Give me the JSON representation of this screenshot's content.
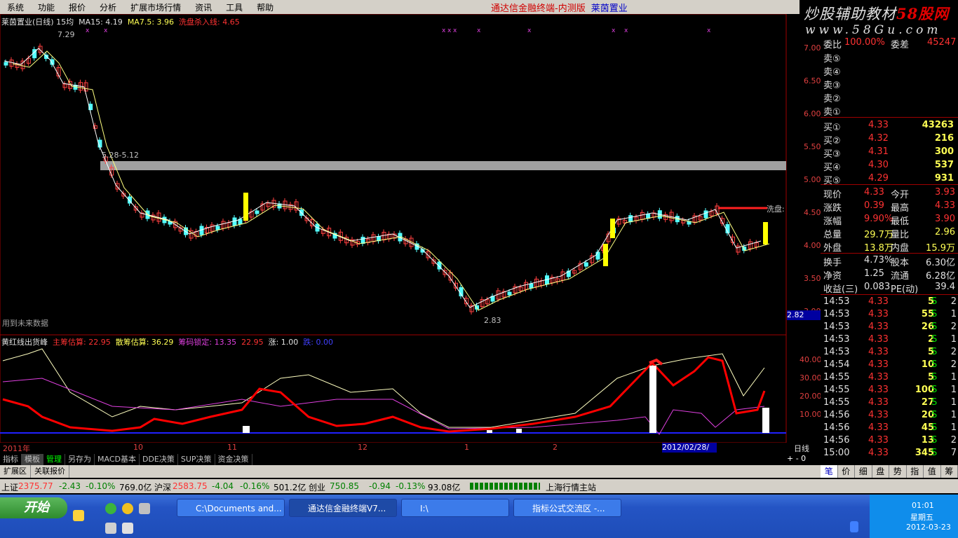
{
  "menu": [
    "系统",
    "功能",
    "报价",
    "分析",
    "扩展市场行情",
    "资讯",
    "工具",
    "帮助"
  ],
  "window_title": "通达信金融终端-内测版",
  "window_stock": "莱茵置业",
  "logo": {
    "text1a": "炒股辅助教材",
    "text1b": "58股网",
    "text2": "www.58Gu.com"
  },
  "chart_header": {
    "name": "莱茵置业(日线)",
    "period": "15均",
    "ma15": "MA15: 4.19",
    "ma75": "MA7.5: 3.96",
    "signal": "洗盘杀入线: 4.65"
  },
  "price_labels": {
    "high": "7.29",
    "range": "5.28-5.12",
    "low": "2.83",
    "wash": "洗盘:",
    "future": "用到未来数据",
    "cur_box": "2.82"
  },
  "indicator_header": {
    "name": "黄红线出货峰",
    "a": "主筹估算: 22.95",
    "b": "散筹估算: 36.29",
    "c": "筹码锁定: 13.35",
    "d": "22.95",
    "e": "涨: 1.00",
    "f": "跌: 0.00"
  },
  "axis_months": [
    "2011年",
    "10",
    "11",
    "12",
    "1",
    "2"
  ],
  "axis_date_box": "2012/02/28/二",
  "axis_right_label": "日线",
  "y_axis_top": [
    "7.00",
    "6.50",
    "6.00",
    "5.50",
    "5.00",
    "4.50",
    "4.00",
    "3.50",
    "3.00"
  ],
  "y_axis_bottom": [
    "40.00",
    "30.00",
    "20.00",
    "10.00"
  ],
  "orderbook": {
    "top_label": "委比",
    "top_val": "100.00%",
    "top_label2": "委差",
    "top_val2": "45247",
    "sells": [
      "卖⑤",
      "卖④",
      "卖③",
      "卖②",
      "卖①"
    ],
    "buys": [
      {
        "l": "买①",
        "p": "4.33",
        "v": "43263"
      },
      {
        "l": "买②",
        "p": "4.32",
        "v": "216"
      },
      {
        "l": "买③",
        "p": "4.31",
        "v": "300"
      },
      {
        "l": "买④",
        "p": "4.30",
        "v": "537"
      },
      {
        "l": "买⑤",
        "p": "4.29",
        "v": "931"
      }
    ]
  },
  "quote": [
    {
      "a": "现价",
      "av": "4.33",
      "b": "今开",
      "bv": "3.93"
    },
    {
      "a": "涨跌",
      "av": "0.39",
      "b": "最高",
      "bv": "4.33"
    },
    {
      "a": "涨幅",
      "av": "9.90%",
      "b": "最低",
      "bv": "3.90"
    },
    {
      "a": "总量",
      "av": "29.7万",
      "b": "量比",
      "bv": "2.96"
    },
    {
      "a": "外盘",
      "av": "13.8万",
      "b": "内盘",
      "bv": "15.9万"
    }
  ],
  "quote2": [
    {
      "a": "换手",
      "av": "4.73%",
      "b": "股本",
      "bv": "6.30亿"
    },
    {
      "a": "净资",
      "av": "1.25",
      "b": "流通",
      "bv": "6.28亿"
    },
    {
      "a": "收益(三)",
      "av": "0.083",
      "b": "PE(动)",
      "bv": "39.4"
    }
  ],
  "ticks": [
    {
      "t": "14:53",
      "p": "4.33",
      "v": "5",
      "s": "S",
      "n": "2"
    },
    {
      "t": "14:53",
      "p": "4.33",
      "v": "55",
      "s": "S",
      "n": "1"
    },
    {
      "t": "14:53",
      "p": "4.33",
      "v": "26",
      "s": "S",
      "n": "2"
    },
    {
      "t": "14:53",
      "p": "4.33",
      "v": "2",
      "s": "S",
      "n": "1"
    },
    {
      "t": "14:53",
      "p": "4.33",
      "v": "5",
      "s": "S",
      "n": "2"
    },
    {
      "t": "14:54",
      "p": "4.33",
      "v": "10",
      "s": "S",
      "n": "2"
    },
    {
      "t": "14:55",
      "p": "4.33",
      "v": "5",
      "s": "S",
      "n": "1"
    },
    {
      "t": "14:55",
      "p": "4.33",
      "v": "100",
      "s": "S",
      "n": "1"
    },
    {
      "t": "14:55",
      "p": "4.33",
      "v": "27",
      "s": "S",
      "n": "1"
    },
    {
      "t": "14:56",
      "p": "4.33",
      "v": "20",
      "s": "S",
      "n": "1"
    },
    {
      "t": "14:56",
      "p": "4.33",
      "v": "45",
      "s": "S",
      "n": "1"
    },
    {
      "t": "14:56",
      "p": "4.33",
      "v": "13",
      "s": "S",
      "n": "2"
    },
    {
      "t": "15:00",
      "p": "4.33",
      "v": "345",
      "s": "S",
      "n": "7"
    }
  ],
  "bottom_tabs": [
    "指标",
    "模板",
    "管理",
    "另存为",
    "MACD基本",
    "DDE决策",
    "SUP决策",
    "资金决策"
  ],
  "bottom_tabs2": [
    "扩展区",
    "关联报价"
  ],
  "right_tabs": [
    "笔",
    "价",
    "细",
    "盘",
    "势",
    "指",
    "值",
    "筹"
  ],
  "status": {
    "sh_label": "上证",
    "sh_val": "2375.77",
    "sh_chg": "-2.43",
    "sh_pct": "-0.10%",
    "sh_amt": "769.0亿",
    "sz_label": "沪深",
    "sz_val": "2583.75",
    "sz_chg": "-4.04",
    "sz_pct": "-0.16%",
    "sz_amt": "501.2亿",
    "cy_label": "创业",
    "cy_val": "750.85",
    "cy_chg": "-0.94",
    "cy_pct": "-0.13%",
    "cy_amt": "93.08亿",
    "site": "上海行情主站"
  },
  "taskbar": {
    "start": "开始",
    "items": [
      "C:\\Documents and...",
      "通达信金融终端V7...",
      "I:\\",
      "指标公式交流区 -..."
    ],
    "time": "01:01",
    "weekday": "星期五",
    "date": "2012-03-23"
  }
}
